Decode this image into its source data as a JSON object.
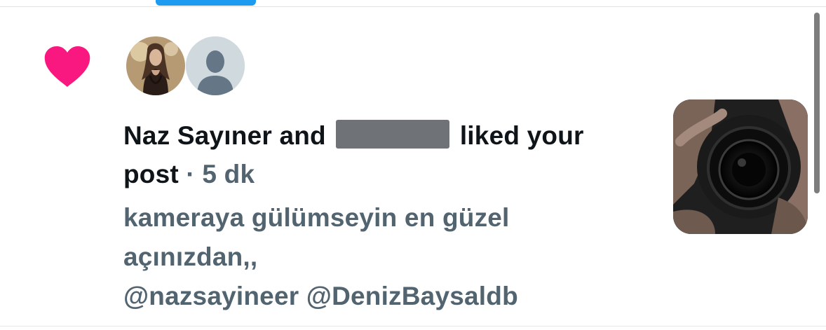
{
  "notification": {
    "icon": "heart-icon",
    "icon_color": "#f91880",
    "avatars": [
      {
        "name": "Naz Sayıner",
        "type": "photo"
      },
      {
        "name": "",
        "type": "default-avatar"
      }
    ],
    "liker_1": "Naz Sayıner",
    "connector": "and",
    "liker_2_redacted": true,
    "action_text": "liked your post",
    "separator": "·",
    "time_ago": "5 dk",
    "preview_lines": [
      "kameraya gülümseyin en güzel",
      "açınızdan,,",
      "@nazsayineer @DenizBaysaldb"
    ],
    "thumbnail": "camera-photo"
  },
  "colors": {
    "accent": "#1d9bf0",
    "heart": "#f91880",
    "primary_text": "#0f1419",
    "secondary_text": "#536471"
  }
}
